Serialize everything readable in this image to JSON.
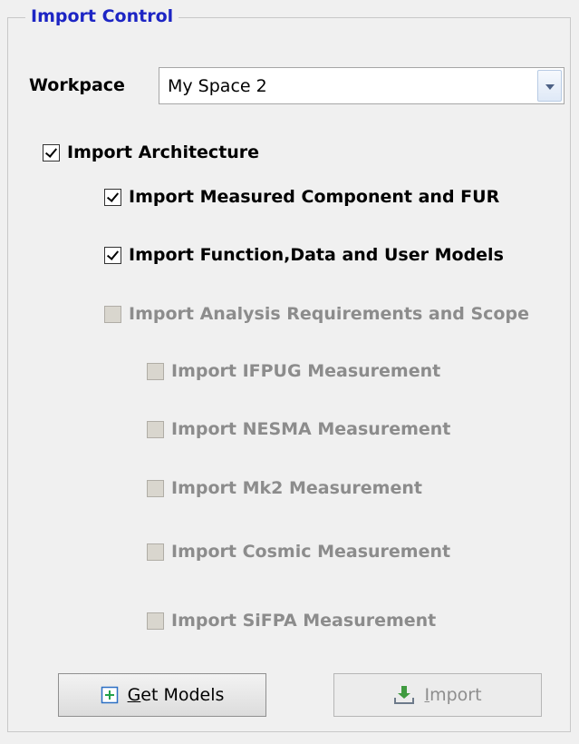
{
  "group": {
    "title": "Import Control"
  },
  "workspace": {
    "label": "Workpace",
    "value": "My Space 2"
  },
  "options": [
    {
      "label": "Import Architecture",
      "checked": true,
      "enabled": true
    },
    {
      "label": "Import Measured Component and FUR",
      "checked": true,
      "enabled": true
    },
    {
      "label": "Import Function,Data and User  Models",
      "checked": true,
      "enabled": true
    },
    {
      "label": "Import Analysis Requirements and Scope",
      "checked": false,
      "enabled": false
    },
    {
      "label": "Import IFPUG Measurement",
      "checked": false,
      "enabled": false
    },
    {
      "label": "Import NESMA Measurement",
      "checked": false,
      "enabled": false
    },
    {
      "label": "Import Mk2 Measurement",
      "checked": false,
      "enabled": false
    },
    {
      "label": "Import Cosmic Measurement",
      "checked": false,
      "enabled": false
    },
    {
      "label": "Import SiFPA Measurement",
      "checked": false,
      "enabled": false
    }
  ],
  "buttons": {
    "get_models": {
      "mnemonic": "G",
      "rest": "et Models",
      "enabled": true,
      "icon": "plus-square-icon"
    },
    "import": {
      "mnemonic": "I",
      "rest": "mport",
      "enabled": false,
      "icon": "download-tray-icon"
    }
  }
}
